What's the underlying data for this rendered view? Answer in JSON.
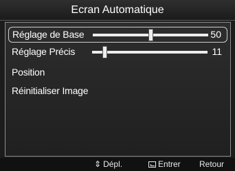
{
  "menu": {
    "title": "Ecran Automatique",
    "items": [
      {
        "label": "Réglage de Base",
        "value": "50",
        "level": 0.5,
        "selected": true
      },
      {
        "label": "Réglage Précis",
        "value": "11",
        "level": 0.11,
        "selected": false
      },
      {
        "label": "Position"
      },
      {
        "label": "Réinitialiser Image"
      }
    ]
  },
  "footer": {
    "move_icon": "updown-arrows-icon",
    "move_glyph": "⇕",
    "move_label": "Dépl.",
    "enter_icon": "enter-icon",
    "enter_label": "Entrer",
    "return_label": "Retour"
  }
}
